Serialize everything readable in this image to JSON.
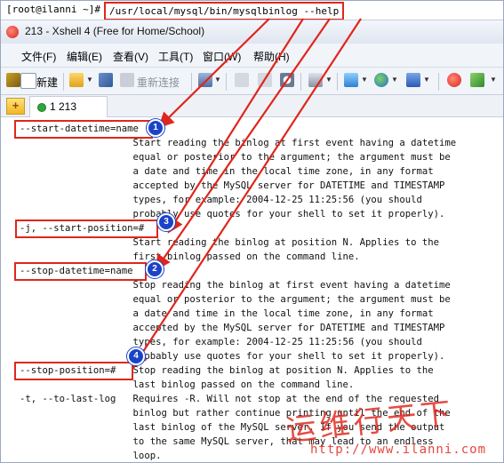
{
  "terminal_top": {
    "prompt": "[root@ilanni ~]#",
    "command": "/usr/local/mysql/bin/mysqlbinlog --help"
  },
  "window": {
    "title": "213 - Xshell 4 (Free for Home/School)"
  },
  "menu": [
    "文件(F)",
    "编辑(E)",
    "查看(V)",
    "工具(T)",
    "窗口(W)",
    "帮助(H)"
  ],
  "toolbar": {
    "new_label": "新建",
    "reconnect_label": "重新连接"
  },
  "tabs": {
    "active_label": "1 213"
  },
  "terminal": {
    "lines": [
      "--start-datetime=name",
      "                    Start reading the binlog at first event having a datetime",
      "                    equal or posterior to the argument; the argument must be",
      "                    a date and time in the local time zone, in any format",
      "                    accepted by the MySQL server for DATETIME and TIMESTAMP",
      "                    types, for example: 2004-12-25 11:25:56 (you should",
      "                    probably use quotes for your shell to set it properly).",
      "-j, --start-position=#",
      "                    Start reading the binlog at position N. Applies to the",
      "                    first binlog passed on the command line.",
      "--stop-datetime=name",
      "                    Stop reading the binlog at first event having a datetime",
      "                    equal or posterior to the argument; the argument must be",
      "                    a date and time in the local time zone, in any format",
      "                    accepted by the MySQL server for DATETIME and TIMESTAMP",
      "                    types, for example: 2004-12-25 11:25:56 (you should",
      "                    probably use quotes for your shell to set it properly).",
      "--stop-position=#   Stop reading the binlog at position N. Applies to the",
      "                    last binlog passed on the command line.",
      "-t, --to-last-log   Requires -R. Will not stop at the end of the requested",
      "                    binlog but rather continue printing until the end of the",
      "                    last binlog of the MySQL server. If you send the output",
      "                    to the same MySQL server, that may lead to an endless",
      "                    loop."
    ]
  },
  "badges": [
    "1",
    "2",
    "3",
    "4"
  ],
  "watermark": {
    "text": "运维行天下",
    "url": "http://www.ilanni.com"
  },
  "colors": {
    "highlight": "#e0261c",
    "badge": "#1b43c8"
  }
}
